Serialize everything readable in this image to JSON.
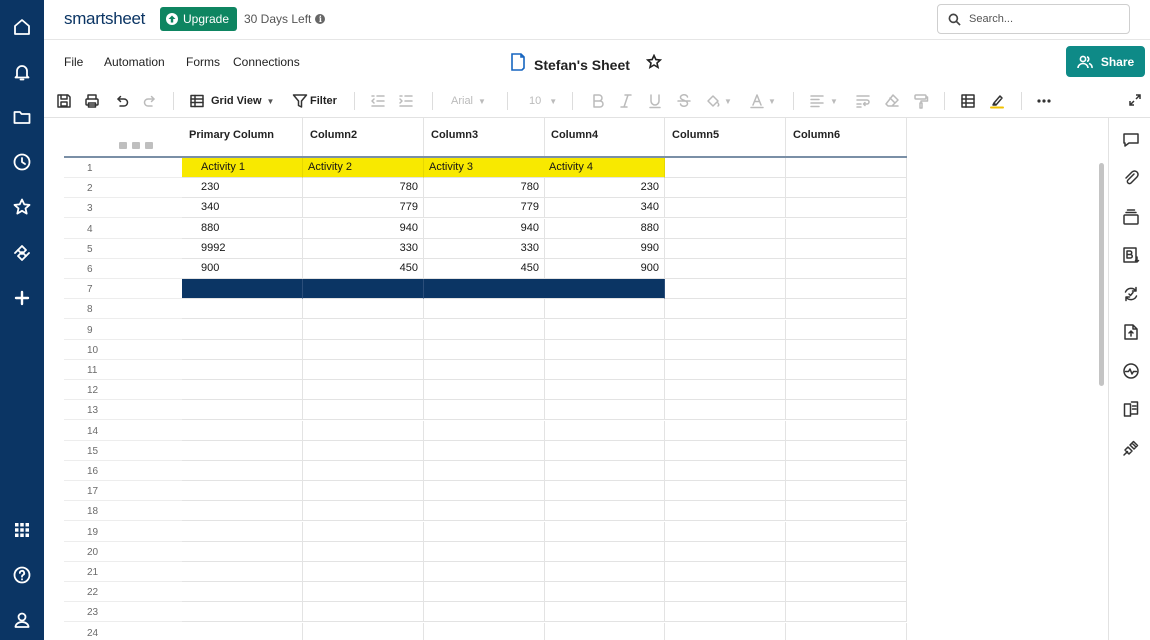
{
  "app": {
    "logo": "smartsheet",
    "upgrade_label": "Upgrade",
    "trial_text": "30 Days Left",
    "search_placeholder": "Search...",
    "accent_color": "#0e8a87",
    "nav_color": "#0b3564"
  },
  "rail_icons": [
    "home-icon",
    "bell-icon",
    "folder-icon",
    "clock-icon",
    "star-icon",
    "workapps-icon",
    "plus-icon",
    "grid-apps-icon",
    "help-icon",
    "account-icon"
  ],
  "menu": [
    "File",
    "Automation",
    "Forms",
    "Connections"
  ],
  "sheet": {
    "title": "Stefan's Sheet"
  },
  "share_label": "Share",
  "toolbar": {
    "view_label": "Grid View",
    "filter_label": "Filter",
    "font": "Arial",
    "font_size": "10"
  },
  "columns": [
    "Primary Column",
    "Column2",
    "Column3",
    "Column4",
    "Column5",
    "Column6"
  ],
  "rows": [
    {
      "n": "1",
      "cells": [
        "Activity 1",
        "Activity 2",
        "Activity 3",
        "Activity 4",
        "",
        ""
      ],
      "style": "header"
    },
    {
      "n": "2",
      "cells": [
        "230",
        "780",
        "780",
        "230",
        "",
        ""
      ]
    },
    {
      "n": "3",
      "cells": [
        "340",
        "779",
        "779",
        "340",
        "",
        ""
      ]
    },
    {
      "n": "4",
      "cells": [
        "880",
        "940",
        "940",
        "880",
        "",
        ""
      ]
    },
    {
      "n": "5",
      "cells": [
        "9992",
        "330",
        "330",
        "990",
        "",
        ""
      ]
    },
    {
      "n": "6",
      "cells": [
        "900",
        "450",
        "450",
        "900",
        "",
        ""
      ]
    },
    {
      "n": "7",
      "cells": [
        "",
        "",
        "",
        "",
        "",
        ""
      ],
      "style": "selected"
    },
    {
      "n": "8"
    },
    {
      "n": "9"
    },
    {
      "n": "10"
    },
    {
      "n": "11"
    },
    {
      "n": "12"
    },
    {
      "n": "13"
    },
    {
      "n": "14"
    },
    {
      "n": "15"
    },
    {
      "n": "16"
    },
    {
      "n": "17"
    },
    {
      "n": "18"
    },
    {
      "n": "19"
    },
    {
      "n": "20"
    },
    {
      "n": "21"
    },
    {
      "n": "22"
    },
    {
      "n": "23"
    },
    {
      "n": "24"
    }
  ],
  "right_panel_icons": [
    "comments-icon",
    "attachments-icon",
    "proofs-icon",
    "summary-icon",
    "update-requests-icon",
    "publish-icon",
    "activity-log-icon",
    "forms-icon",
    "connections-icon"
  ]
}
